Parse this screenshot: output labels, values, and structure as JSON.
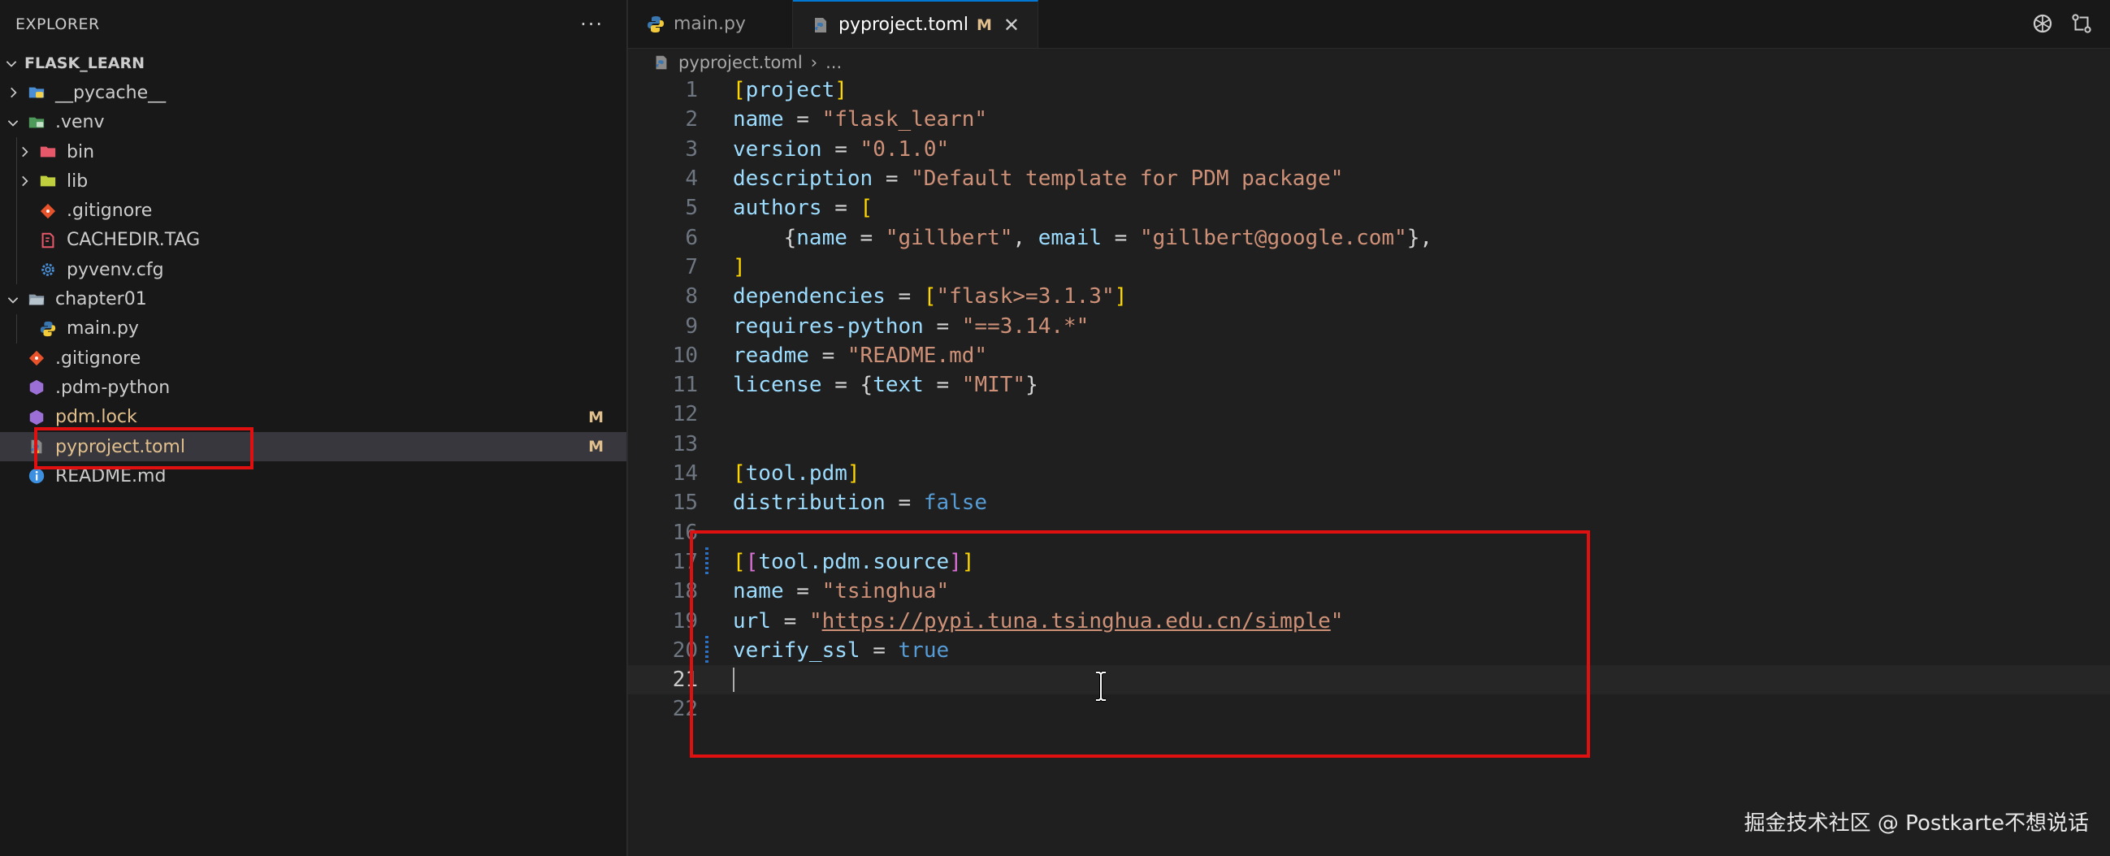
{
  "sidebar": {
    "title": "EXPLORER",
    "more_icon": "more-icon",
    "root": "FLASK_LEARN",
    "items": [
      {
        "label": "__pycache__",
        "type": "folder",
        "expanded": false,
        "badge": ""
      },
      {
        "label": ".venv",
        "type": "folder",
        "expanded": true,
        "badge": ""
      },
      {
        "label": "bin",
        "type": "folder",
        "expanded": false,
        "badge": ""
      },
      {
        "label": "lib",
        "type": "folder",
        "expanded": false,
        "badge": ""
      },
      {
        "label": ".gitignore",
        "type": "git",
        "badge": ""
      },
      {
        "label": "CACHEDIR.TAG",
        "type": "tag",
        "badge": ""
      },
      {
        "label": "pyvenv.cfg",
        "type": "cfg",
        "badge": ""
      },
      {
        "label": "chapter01",
        "type": "folder",
        "expanded": true,
        "badge": ""
      },
      {
        "label": "main.py",
        "type": "python",
        "badge": ""
      },
      {
        "label": ".gitignore",
        "type": "git",
        "badge": ""
      },
      {
        "label": ".pdm-python",
        "type": "pdm",
        "badge": ""
      },
      {
        "label": "pdm.lock",
        "type": "pdm",
        "badge": "M"
      },
      {
        "label": "pyproject.toml",
        "type": "toml",
        "badge": "M",
        "selected": true
      },
      {
        "label": "README.md",
        "type": "info",
        "badge": ""
      }
    ]
  },
  "tabs": [
    {
      "label": "main.py",
      "icon": "python-icon",
      "active": false
    },
    {
      "label": "pyproject.toml",
      "icon": "toml-icon",
      "active": true,
      "modified": "M",
      "close": "✕"
    }
  ],
  "breadcrumb": {
    "file": "pyproject.toml",
    "rest": "..."
  },
  "editor": {
    "current_line": 21,
    "line_numbers": [
      "1",
      "2",
      "3",
      "4",
      "5",
      "6",
      "7",
      "8",
      "9",
      "10",
      "11",
      "12",
      "13",
      "14",
      "15",
      "16",
      "17",
      "18",
      "19",
      "20",
      "21",
      "22"
    ]
  },
  "code": {
    "l1_section": "project",
    "l2_key": "name",
    "l2_val": "\"flask_learn\"",
    "l3_key": "version",
    "l3_val": "\"0.1.0\"",
    "l4_key": "description",
    "l4_val": "\"Default template for PDM package\"",
    "l5_key": "authors",
    "l6_k1": "name",
    "l6_v1": "\"gillbert\"",
    "l6_k2": "email",
    "l6_v2": "\"gillbert@google.com\"",
    "l8_key": "dependencies",
    "l8_val": "\"flask>=3.1.3\"",
    "l9_key": "requires-python",
    "l9_val": "\"==3.14.*\"",
    "l10_key": "readme",
    "l10_val": "\"README.md\"",
    "l11_key": "license",
    "l11_k": "text",
    "l11_v": "\"MIT\"",
    "l14_section": "tool.pdm",
    "l15_key": "distribution",
    "l15_val": "false",
    "l17_section": "tool.pdm.source",
    "l18_key": "name",
    "l18_val": "\"tsinghua\"",
    "l19_key": "url",
    "l19_url": "https://pypi.tuna.tsinghua.edu.cn/simple",
    "l20_key": "verify_ssl",
    "l20_val": "true"
  },
  "watermark": "掘金技术社区 @ Postkarte不想说话",
  "colors": {
    "accent": "#0078d4",
    "annotation": "#e01010",
    "modified": "#e2c08d"
  }
}
